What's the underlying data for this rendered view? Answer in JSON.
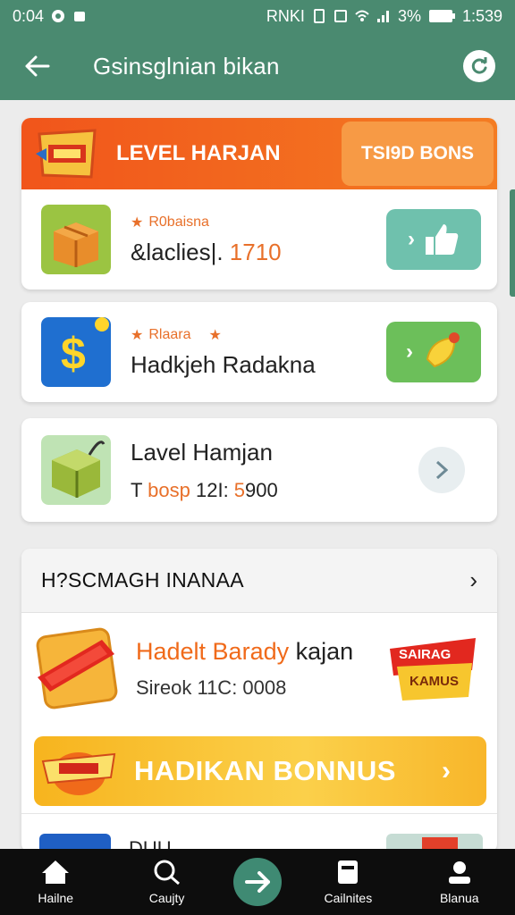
{
  "status_bar": {
    "time_left": "0:04",
    "battery": "3%",
    "time_right": "1:539",
    "carrier": "RNKI"
  },
  "app_bar": {
    "title": "Gsinsglnian bikan"
  },
  "banner": {
    "title": "LEVEL HARJAN",
    "button_label": "TSI9D BONS"
  },
  "rows": [
    {
      "subtitle": "R0baisna",
      "title": "&laclies|. ",
      "title_number": "1710"
    },
    {
      "subtitle": "Rlaara",
      "title": "Hadkjeh Radakna"
    },
    {
      "title": "Lavel Hamjan",
      "detail_prefix": "T ",
      "detail_highlight": "bosp",
      "detail_mid": " 12I: ",
      "detail_number": "5",
      "detail_suffix": "900"
    }
  ],
  "section": {
    "title": "H?SCMAGH INANAA",
    "promo_title_orange": "Hadelt Barady",
    "promo_title_dark": " kajan",
    "promo_sub": "Sireok 11C: 0008",
    "badge_line1": "SAIRAG",
    "badge_line2": "KAMUS",
    "gold_button": "HADIKAN BONNUS",
    "peek_text": "DUU     ."
  },
  "bottom_nav": [
    {
      "label": "Hailne"
    },
    {
      "label": "Caujty"
    },
    {
      "label": "Cailnites"
    },
    {
      "label": "Blanua"
    }
  ],
  "colors": {
    "primary": "#4a8a70",
    "orange": "#f1551b",
    "gold": "#f7b41e"
  }
}
